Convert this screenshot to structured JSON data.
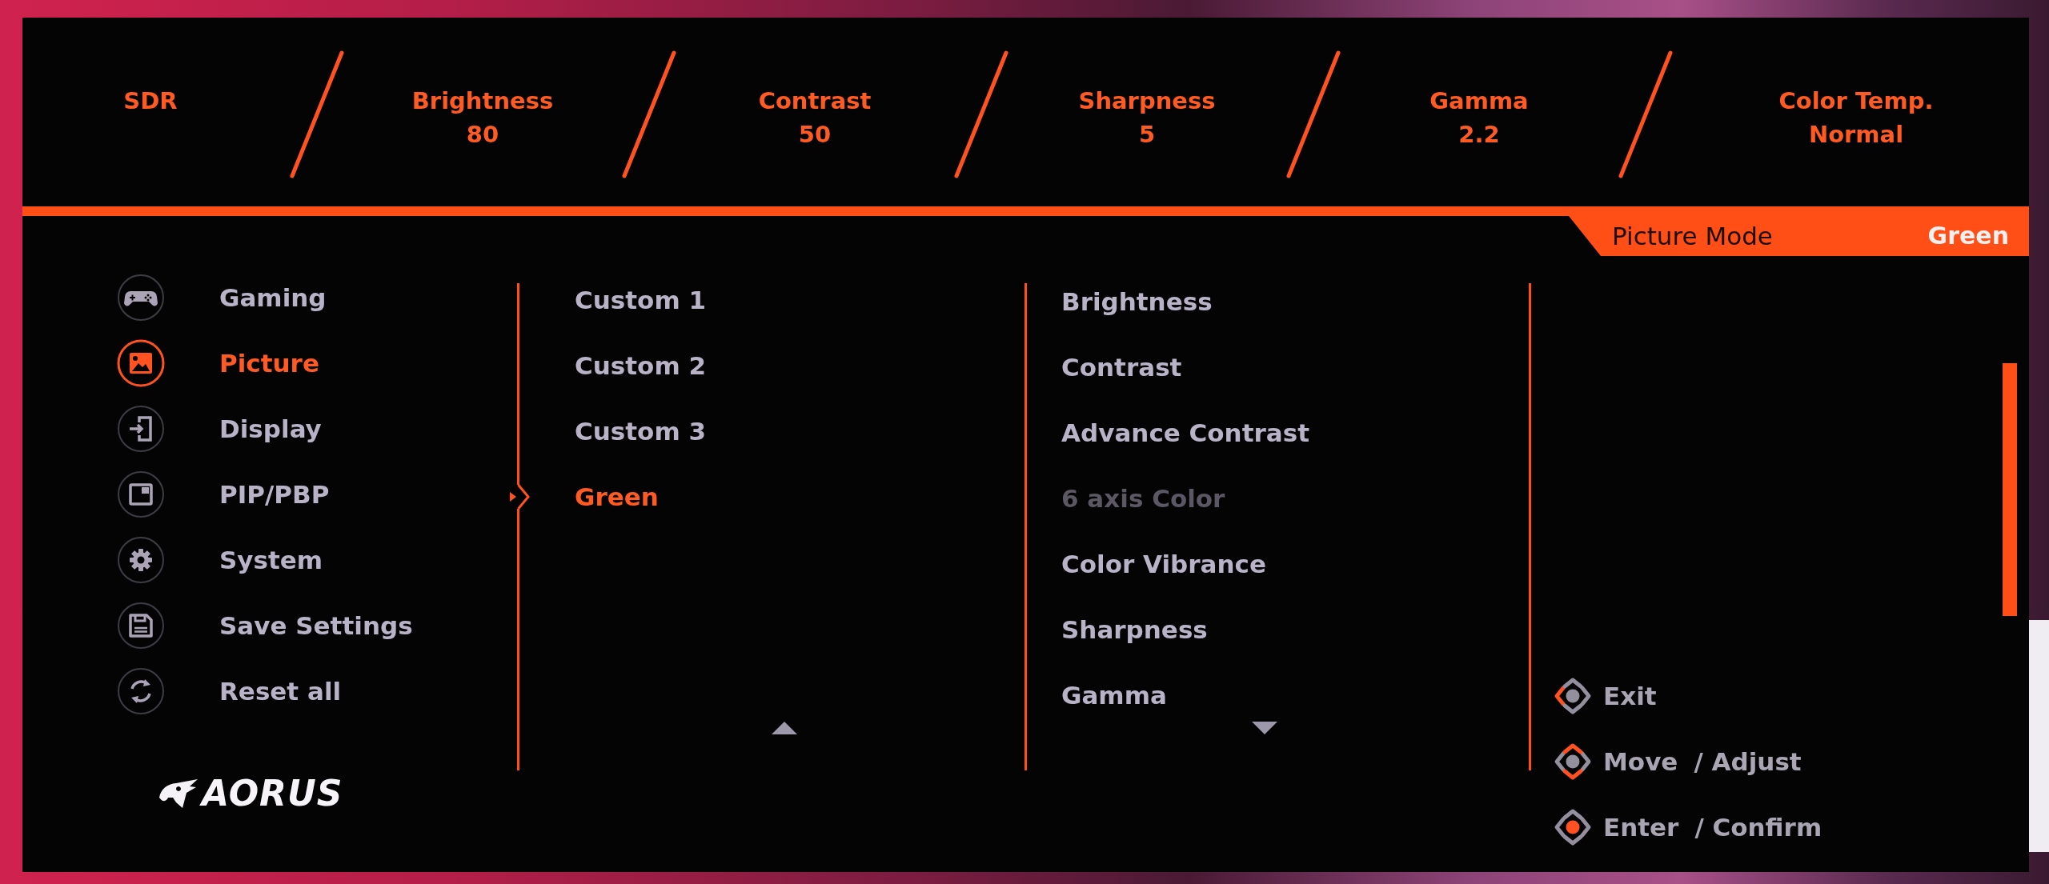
{
  "osd_header": {
    "items": [
      {
        "label": "SDR"
      },
      {
        "label": "Brightness",
        "value": "80"
      },
      {
        "label": "Contrast",
        "value": "50"
      },
      {
        "label": "Sharpness",
        "value": "5"
      },
      {
        "label": "Gamma",
        "value": "2.2"
      },
      {
        "label": "Color Temp.",
        "value": "Normal"
      }
    ]
  },
  "mode_banner": {
    "label": "Picture Mode",
    "value": "Green"
  },
  "main_menu": {
    "items": [
      {
        "label": "Gaming",
        "selected": false
      },
      {
        "label": "Picture",
        "selected": true
      },
      {
        "label": "Display",
        "selected": false
      },
      {
        "label": "PIP/PBP",
        "selected": false
      },
      {
        "label": "System",
        "selected": false
      },
      {
        "label": "Save Settings",
        "selected": false
      },
      {
        "label": "Reset all",
        "selected": false
      }
    ]
  },
  "logo": {
    "text": "AORUS"
  },
  "submenu": {
    "items": [
      {
        "label": "Custom 1",
        "selected": false
      },
      {
        "label": "Custom 2",
        "selected": false
      },
      {
        "label": "Custom 3",
        "selected": false
      },
      {
        "label": "Green",
        "selected": true
      }
    ]
  },
  "settings": {
    "items": [
      {
        "label": "Brightness",
        "disabled": false
      },
      {
        "label": "Contrast",
        "disabled": false
      },
      {
        "label": "Advance Contrast",
        "disabled": false
      },
      {
        "label": "6 axis Color",
        "disabled": true
      },
      {
        "label": "Color Vibrance",
        "disabled": false
      },
      {
        "label": "Sharpness",
        "disabled": false
      },
      {
        "label": "Gamma",
        "disabled": false
      }
    ]
  },
  "key_guide": {
    "items": [
      {
        "action": "Exit",
        "kind": "left"
      },
      {
        "action": "Move",
        "alt_action": "/ Adjust",
        "kind": "vertical"
      },
      {
        "action": "Enter",
        "alt_action": "/ Confirm",
        "kind": "center"
      }
    ]
  }
}
